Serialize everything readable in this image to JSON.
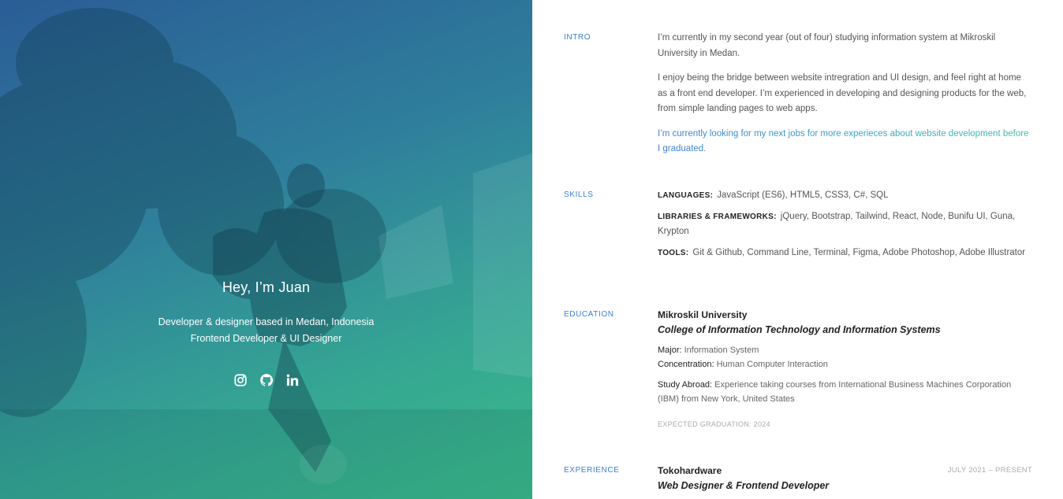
{
  "hero": {
    "name": "Hey, I’m Juan",
    "subtitle_line1": "Developer & designer based in Medan, Indonesia",
    "subtitle_line2": "Frontend Developer & UI Designer",
    "socials": [
      {
        "label": "Instagram",
        "icon": "instagram-icon"
      },
      {
        "label": "GitHub",
        "icon": "github-icon"
      },
      {
        "label": "LinkedIn",
        "icon": "linkedin-icon"
      }
    ],
    "colors": {
      "gradient_start": "#2a5d96",
      "gradient_end": "#3bbb89"
    }
  },
  "intro": {
    "label": "INTRO",
    "paragraphs": [
      "I’m currently in my second year (out of four) studying information system at Mikroskil University in Medan.",
      "I enjoy being the bridge between website intregration and UI design, and feel right at home as a front end developer. I’m experienced in developing and designing products for the web, from simple landing pages to web apps."
    ],
    "accent": "I’m currently looking for my next jobs for more experieces about website development before I graduated."
  },
  "skills": {
    "label": "SKILLS",
    "rows": [
      {
        "key": "LANGUAGES:",
        "value": "JavaScript (ES6), HTML5, CSS3, C#, SQL"
      },
      {
        "key": "LIBRARIES & FRAMEWORKS:",
        "value": "jQuery, Bootstrap, Tailwind, React, Node, Bunifu UI, Guna, Krypton"
      },
      {
        "key": "TOOLS:",
        "value": "Git & Github, Command Line, Terminal, Figma, Adobe Photoshop, Adobe Illustrator"
      }
    ]
  },
  "education": {
    "label": "EDUCATION",
    "school": "Mikroskil University",
    "college": "College of Information Technology and Information Systems",
    "major_key": "Major:",
    "major_value": "Information System",
    "concentration_key": "Concentration:",
    "concentration_value": "Human Computer Interaction",
    "abroad_key": "Study Abroad:",
    "abroad_value": "Experience taking courses from International Business Machines Corporation (IBM) from New York, United States",
    "graduation": "EXPECTED GRADUATION: 2024"
  },
  "experience": {
    "label": "EXPERIENCE",
    "company": "Tokohardware",
    "role": "Web Designer & Frontend Developer",
    "dates": "JULY 2021 – PRESENT"
  }
}
